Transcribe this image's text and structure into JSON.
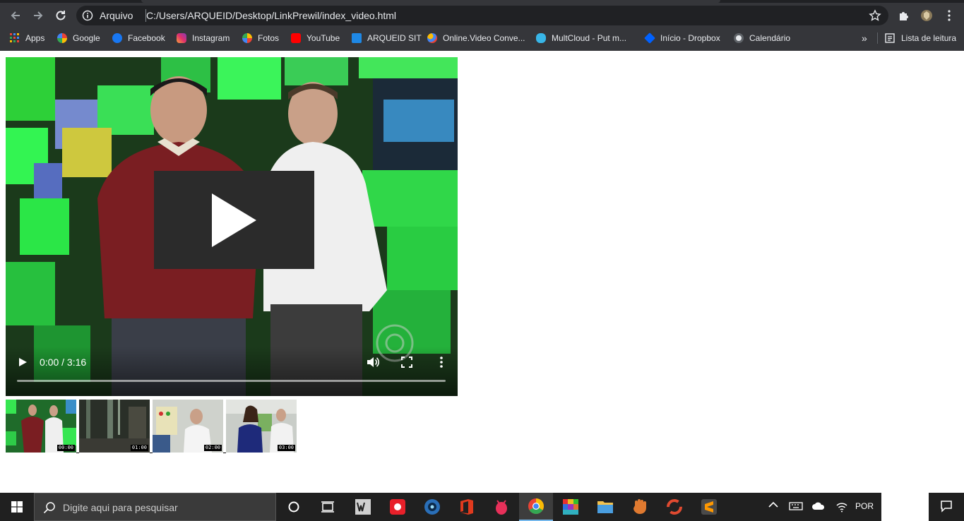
{
  "browser": {
    "omnibox": {
      "security_label": "Arquivo",
      "url": "C:/Users/ARQUEID/Desktop/LinkPrewil/index_video.html"
    },
    "bookmarks": [
      {
        "label": "Apps",
        "icon": "apps-grid-icon"
      },
      {
        "label": "Google",
        "icon": "google-icon"
      },
      {
        "label": "Facebook",
        "icon": "facebook-icon"
      },
      {
        "label": "Instagram",
        "icon": "instagram-icon"
      },
      {
        "label": "Fotos",
        "icon": "photos-icon"
      },
      {
        "label": "YouTube",
        "icon": "youtube-icon"
      },
      {
        "label": "ARQUEID SIT",
        "icon": "wn-icon"
      },
      {
        "label": "Online.Video Conve...",
        "icon": "online-video-icon"
      },
      {
        "label": "MultCloud - Put m...",
        "icon": "multcloud-icon"
      },
      {
        "label": "Início - Dropbox",
        "icon": "dropbox-icon"
      },
      {
        "label": "Calendário",
        "icon": "globe-icon"
      }
    ],
    "overflow_label": "»",
    "reading_list_label": "Lista de leitura"
  },
  "video": {
    "time_display": "0:00 / 3:16",
    "progress": 0
  },
  "thumbnails": [
    {
      "time": "00:00"
    },
    {
      "time": "01:00"
    },
    {
      "time": "02:00"
    },
    {
      "time": "03:00"
    }
  ],
  "taskbar": {
    "search_placeholder": "Digite aqui para pesquisar",
    "language": "POR"
  },
  "colors": {
    "chrome_bg": "#35363a",
    "omnibox_bg": "#202124",
    "taskbar_bg": "#202020",
    "accent": "#76b9ed"
  }
}
